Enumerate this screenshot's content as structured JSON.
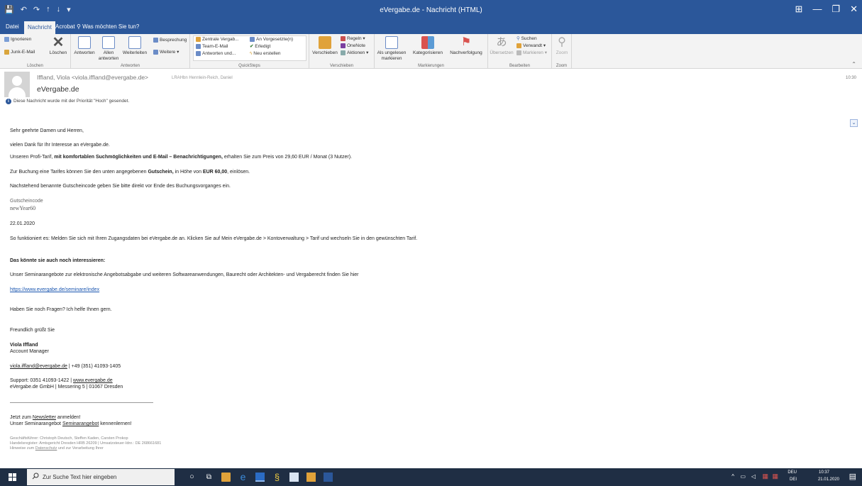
{
  "window": {
    "title": "eVergabe.de - Nachricht (HTML)",
    "qat": [
      "💾",
      "↶",
      "↷",
      "↑",
      "↓",
      "▾"
    ],
    "controls": [
      "⊞",
      "—",
      "❐",
      "✕"
    ]
  },
  "tabs": [
    "Datei",
    "Nachricht",
    "Acrobat",
    "Was möchten Sie tun?"
  ],
  "ribbon": {
    "delete_group": {
      "label": "Löschen",
      "ignore": "Ignorieren",
      "junk": "Junk-E-Mail",
      "delete": "Löschen"
    },
    "respond_group": {
      "label": "Antworten",
      "reply": "Antworten",
      "reply_all": "Allen antworten",
      "forward": "Weiterleiten",
      "meeting": "Besprechung",
      "more": "Weitere"
    },
    "quicksteps_group": {
      "label": "QuickSteps",
      "items": [
        "Zentrale Vergab...",
        "Team-E-Mail",
        "Antworten und...",
        "An Vorgesetzte(n)",
        "Erledigt",
        "Neu erstellen"
      ]
    },
    "move_group": {
      "label": "Verschieben",
      "move": "Verschieben",
      "rules": "Regeln",
      "onenote": "OneNote",
      "actions": "Aktionen"
    },
    "tags_group": {
      "label": "Markierungen",
      "unread": "Als ungelesen markieren",
      "categorize": "Kategorisieren",
      "followup": "Nachverfolgung"
    },
    "edit_group": {
      "label": "Bearbeiten",
      "translate": "Übersetzen",
      "find": "Suchen",
      "related": "Verwandt",
      "select": "Markieren"
    },
    "zoom_group": {
      "label": "Zoom",
      "zoom": "Zoom"
    }
  },
  "message": {
    "sender": "Iffland, Viola <viola.iffland@evergabe.de>",
    "recipient": "LRAHbn Hennlein-Reich, Daniel",
    "subject": "eVergabe.de",
    "priority_note": "Diese Nachricht wurde mit der Priorität \"Hoch\" gesendet.",
    "time": "10:30"
  },
  "body": {
    "greeting": "Sehr  geehrte Damen und Herren,",
    "thanks": "vielen Dank für Ihr Interesse an eVergabe.de.",
    "offer_pre": "Unseren Profi-Tarif, ",
    "offer_bold": "mit komfortablen Suchmöglichkeiten und E-Mail – Benachrichtigungen,",
    "offer_post": " erhalten Sie zum Preis von 29,60 EUR / Monat (3  Nutzer).",
    "booking_pre": "Zur Buchung eine Tarifes können Sie den unten angegebenen ",
    "booking_bold1": "Gutschein,",
    "booking_mid": " in Höhe von ",
    "booking_bold2": "EUR 60,00",
    "booking_post": ", einlösen.",
    "instruction": "Nachstehend benannte Gutscheincode geben Sie bitte direkt vor Ende des Buchungsvorganges ein.",
    "code_label": "Gutscheincode",
    "code_value": "newYear60",
    "date": "22.01.2020",
    "howto": "So funktioniert es: Melden Sie sich mit Ihren Zugangsdaten bei eVergabe.de an. Klicken Sie auf Mein eVergabe.de > Kontoverwaltung > Tarif und wechseln Sie in den gewünschten Tarif.",
    "interest_heading": "Das könnte sie auch noch interessieren:",
    "seminar_text": "Unser Seminarangebote zur elektronische Angebotsabgabe und weiteren Softwareanwendungen, Baurecht oder Architekten- und Vergaberecht finden Sie hier",
    "seminar_link": "https://www.evergabe.de/seminare/index",
    "questions": "Haben Sie noch Fragen? Ich helfe Ihnen gern.",
    "regards": "Freundlich grüßt Sie",
    "sig_name": "Viola Iffland",
    "sig_role": "Account Manager",
    "sig_email": "viola.iffland@evergabe.de",
    "sig_phone": " | +49 (351) 41093-1405",
    "support_pre": "Support: 0351 41093-1422 | ",
    "support_link": "www.evergabe.de",
    "company": "eVergabe.de GmbH | Messering 5 | 01067 Dresden",
    "newsletter_pre": "Jetzt zum ",
    "newsletter_link": "Newsletter",
    "newsletter_post": " anmelden!",
    "seminar2_pre": "Unser Seminarangebot ",
    "seminar2_link": "Seminarangebot",
    "seminar2_post": " kennenlernen!",
    "footer1": "Geschäftsführer: Christoph Deutsch, Steffen Kaden, Carsten Prokop",
    "footer2": "Handelsregister: Amtsgericht Dresden HRB 26209 | Umsatzsteuer-Idnr.: DE 268661681",
    "footer3_pre": "Hinweise zum ",
    "footer3_link": "Datenschutz",
    "footer3_post": " und zur Verarbeitung Ihrer"
  },
  "taskbar": {
    "search_placeholder": "Zur Suche Text hier eingeben",
    "lang1": "DEU",
    "lang2": "DEI",
    "clock_time": "10:37",
    "clock_date": "21.01.2020"
  },
  "colors": {
    "titlebar": "#2b579a",
    "taskbar": "#1f2e44",
    "link": "#1a56b0"
  }
}
